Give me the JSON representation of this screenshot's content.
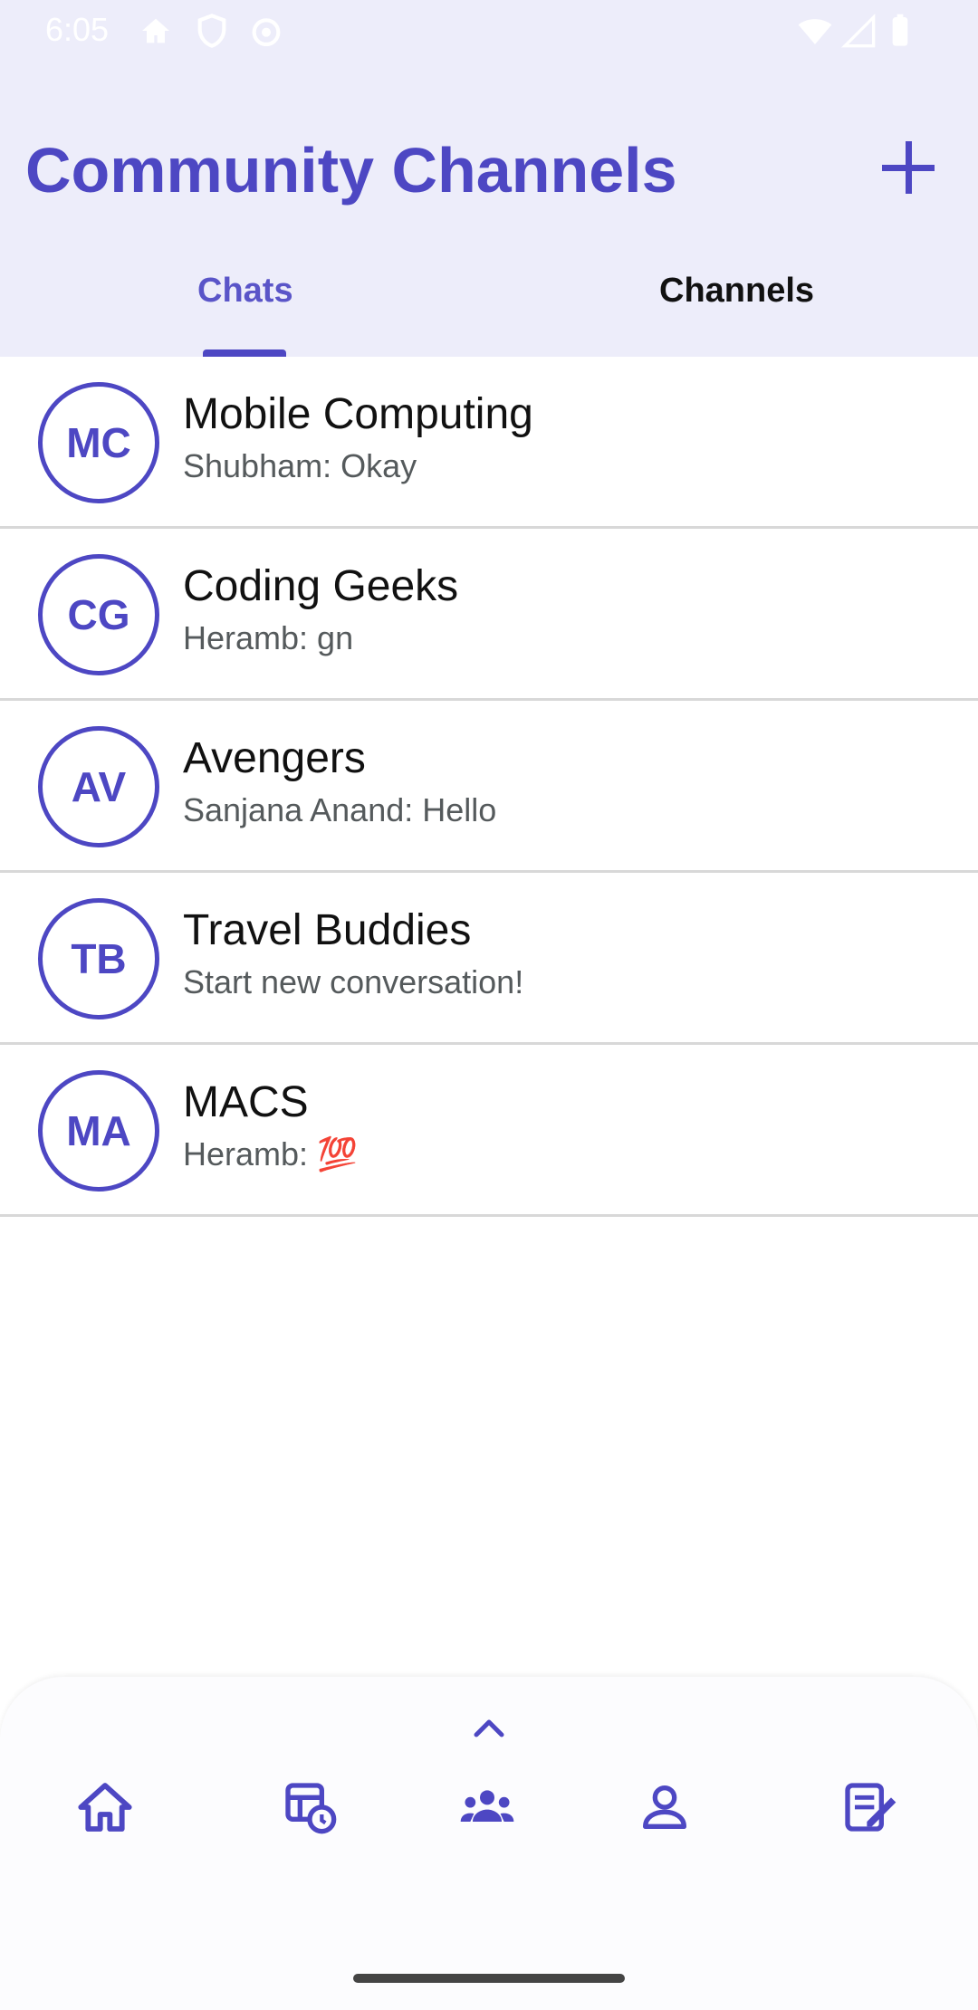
{
  "status_bar": {
    "time": "6:05"
  },
  "header": {
    "title": "Community Channels",
    "tabs": [
      {
        "label": "Chats",
        "selected": true
      },
      {
        "label": "Channels",
        "selected": false
      }
    ]
  },
  "chats": [
    {
      "initials": "MC",
      "name": "Mobile Computing",
      "last_message": "Shubham: Okay"
    },
    {
      "initials": "CG",
      "name": "Coding Geeks",
      "last_message": "Heramb: gn"
    },
    {
      "initials": "AV",
      "name": "Avengers",
      "last_message": "Sanjana Anand: Hello"
    },
    {
      "initials": "TB",
      "name": "Travel Buddies",
      "last_message": "Start new conversation!"
    },
    {
      "initials": "MA",
      "name": "MACS",
      "last_message": "Heramb: 💯"
    }
  ],
  "bottom_nav": {
    "items": [
      "home-icon",
      "schedule-icon",
      "groups-icon",
      "profile-icon",
      "notes-icon"
    ]
  },
  "colors": {
    "accent": "#4d47c3",
    "header_bg": "#ededfa"
  }
}
